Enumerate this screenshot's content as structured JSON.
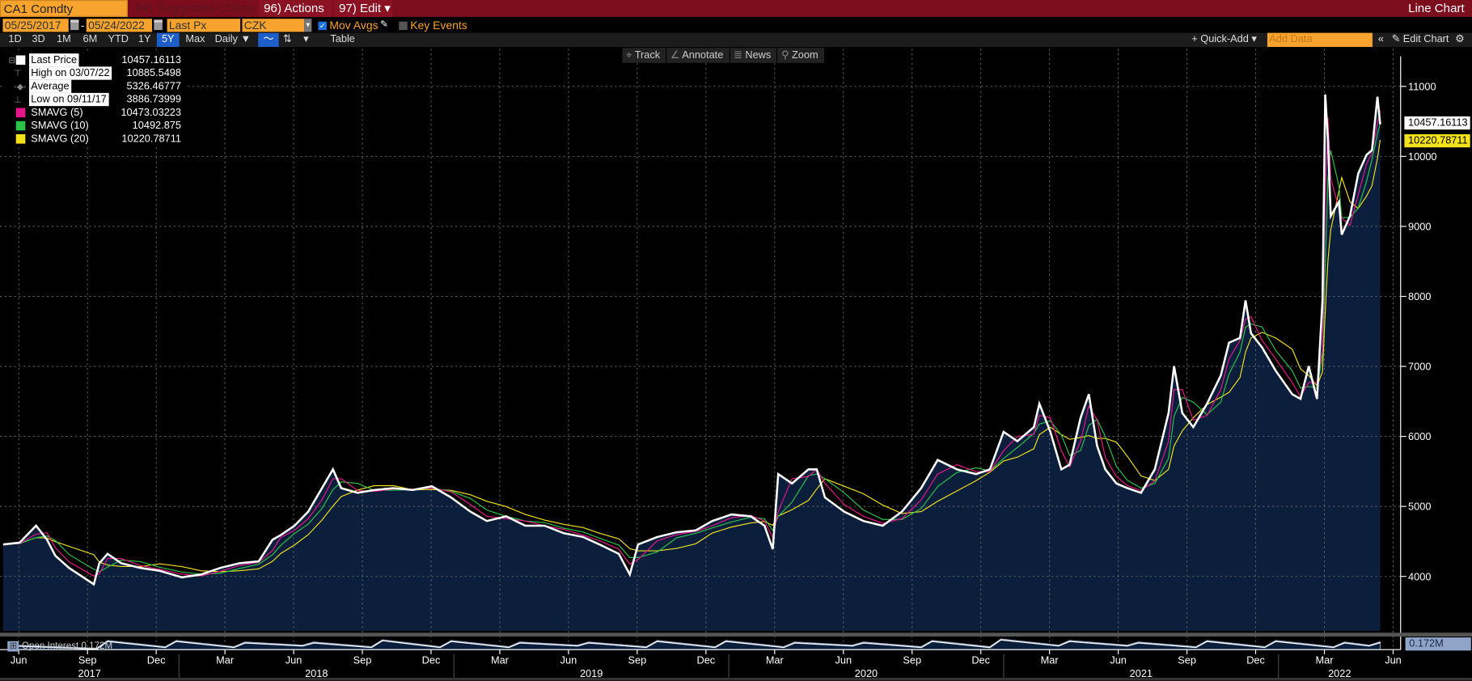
{
  "titlebar": {
    "ticker": "CA1 Comdty",
    "suggested": "94) Suggested Charts",
    "actions": "96) Actions ▾",
    "edit": "97) Edit ▾",
    "view": "Line Chart"
  },
  "controls": {
    "start_date": "05/25/2017",
    "end_date": "05/24/2022",
    "separator": "-",
    "field": "Last Px",
    "currency": "CZK",
    "mov_avgs": "Mov Avgs",
    "mov_avgs_checked": true,
    "key_events": "Key Events",
    "key_events_checked": false
  },
  "periods": [
    "1D",
    "3D",
    "1M",
    "6M",
    "YTD",
    "1Y",
    "5Y",
    "Max"
  ],
  "selected_period": "5Y",
  "frequency": "Daily ▼",
  "table_label": "Table",
  "right_toolbar": {
    "quick_add": "+ Quick-Add ▾",
    "add_data_placeholder": "Add Data",
    "collapse": "«",
    "edit_chart": "Edit Chart"
  },
  "chart_tools": [
    "Track",
    "Annotate",
    "News",
    "Zoom"
  ],
  "legend": [
    {
      "name": "Last Price",
      "value": "10457.16113",
      "color": "#ffffff"
    },
    {
      "name": "High on 03/07/22",
      "value": "10885.5498"
    },
    {
      "name": "Average",
      "value": "5326.46777"
    },
    {
      "name": "Low on 09/11/17",
      "value": "3886.73999"
    },
    {
      "name": "SMAVG (5)",
      "value": "10473.03223",
      "color": "#e8168a"
    },
    {
      "name": "SMAVG (10)",
      "value": "10492.875",
      "color": "#2cc24a"
    },
    {
      "name": "SMAVG (20)",
      "value": "10220.78711",
      "color": "#f2e21c"
    }
  ],
  "price_tags": {
    "last": "10457.16113",
    "smavg20": "10220.78711",
    "open_interest": "0.172M"
  },
  "open_interest_label": "Open Interest 0.172M",
  "chart_data": {
    "type": "area",
    "ylim": [
      3400,
      11500
    ],
    "y_ticks": [
      4000,
      5000,
      6000,
      7000,
      8000,
      9000,
      10000,
      11000
    ],
    "x_ticks": [
      {
        "label": "Jun",
        "t": 2017.417
      },
      {
        "label": "Sep",
        "t": 2017.667
      },
      {
        "label": "Dec",
        "t": 2017.917
      },
      {
        "label": "Mar",
        "t": 2018.167
      },
      {
        "label": "Jun",
        "t": 2018.417
      },
      {
        "label": "Sep",
        "t": 2018.667
      },
      {
        "label": "Dec",
        "t": 2018.917
      },
      {
        "label": "Mar",
        "t": 2019.167
      },
      {
        "label": "Jun",
        "t": 2019.417
      },
      {
        "label": "Sep",
        "t": 2019.667
      },
      {
        "label": "Dec",
        "t": 2019.917
      },
      {
        "label": "Mar",
        "t": 2020.167
      },
      {
        "label": "Jun",
        "t": 2020.417
      },
      {
        "label": "Sep",
        "t": 2020.667
      },
      {
        "label": "Dec",
        "t": 2020.917
      },
      {
        "label": "Mar",
        "t": 2021.167
      },
      {
        "label": "Jun",
        "t": 2021.417
      },
      {
        "label": "Sep",
        "t": 2021.667
      },
      {
        "label": "Dec",
        "t": 2021.917
      },
      {
        "label": "Mar",
        "t": 2022.167
      },
      {
        "label": "Jun",
        "t": 2022.417
      }
    ],
    "years": [
      "2017",
      "2018",
      "2019",
      "2020",
      "2021",
      "2022"
    ],
    "series": [
      {
        "name": "Last Price",
        "points": [
          [
            2017.36,
            4456
          ],
          [
            2017.42,
            4483
          ],
          [
            2017.48,
            4724
          ],
          [
            2017.52,
            4523
          ],
          [
            2017.55,
            4295
          ],
          [
            2017.6,
            4121
          ],
          [
            2017.69,
            3887
          ],
          [
            2017.71,
            4188
          ],
          [
            2017.74,
            4322
          ],
          [
            2017.79,
            4188
          ],
          [
            2017.86,
            4121
          ],
          [
            2017.93,
            4080
          ],
          [
            2018.01,
            3987
          ],
          [
            2018.08,
            4027
          ],
          [
            2018.15,
            4121
          ],
          [
            2018.22,
            4188
          ],
          [
            2018.29,
            4215
          ],
          [
            2018.34,
            4523
          ],
          [
            2018.37,
            4590
          ],
          [
            2018.42,
            4724
          ],
          [
            2018.47,
            4925
          ],
          [
            2018.52,
            5261
          ],
          [
            2018.56,
            5529
          ],
          [
            2018.59,
            5261
          ],
          [
            2018.65,
            5194
          ],
          [
            2018.71,
            5234
          ],
          [
            2018.78,
            5261
          ],
          [
            2018.85,
            5234
          ],
          [
            2018.92,
            5287
          ],
          [
            2018.99,
            5127
          ],
          [
            2019.06,
            4925
          ],
          [
            2019.12,
            4791
          ],
          [
            2019.19,
            4858
          ],
          [
            2019.26,
            4724
          ],
          [
            2019.33,
            4724
          ],
          [
            2019.4,
            4617
          ],
          [
            2019.47,
            4563
          ],
          [
            2019.53,
            4456
          ],
          [
            2019.6,
            4322
          ],
          [
            2019.64,
            4027
          ],
          [
            2019.67,
            4456
          ],
          [
            2019.74,
            4563
          ],
          [
            2019.81,
            4630
          ],
          [
            2019.88,
            4657
          ],
          [
            2019.94,
            4791
          ],
          [
            2020.01,
            4885
          ],
          [
            2020.08,
            4858
          ],
          [
            2020.13,
            4724
          ],
          [
            2020.16,
            4389
          ],
          [
            2020.18,
            5462
          ],
          [
            2020.23,
            5328
          ],
          [
            2020.29,
            5529
          ],
          [
            2020.32,
            5529
          ],
          [
            2020.35,
            5127
          ],
          [
            2020.42,
            4925
          ],
          [
            2020.49,
            4791
          ],
          [
            2020.56,
            4724
          ],
          [
            2020.63,
            4925
          ],
          [
            2020.7,
            5261
          ],
          [
            2020.76,
            5663
          ],
          [
            2020.83,
            5529
          ],
          [
            2020.9,
            5462
          ],
          [
            2020.95,
            5529
          ],
          [
            2021.0,
            6065
          ],
          [
            2021.05,
            5931
          ],
          [
            2021.11,
            6132
          ],
          [
            2021.13,
            6467
          ],
          [
            2021.17,
            6065
          ],
          [
            2021.21,
            5529
          ],
          [
            2021.24,
            5596
          ],
          [
            2021.28,
            6266
          ],
          [
            2021.31,
            6602
          ],
          [
            2021.34,
            5864
          ],
          [
            2021.37,
            5529
          ],
          [
            2021.41,
            5328
          ],
          [
            2021.45,
            5261
          ],
          [
            2021.5,
            5194
          ],
          [
            2021.55,
            5529
          ],
          [
            2021.6,
            6333
          ],
          [
            2021.62,
            7004
          ],
          [
            2021.65,
            6333
          ],
          [
            2021.69,
            6132
          ],
          [
            2021.74,
            6467
          ],
          [
            2021.79,
            6870
          ],
          [
            2021.82,
            7339
          ],
          [
            2021.86,
            7406
          ],
          [
            2021.88,
            7942
          ],
          [
            2021.9,
            7473
          ],
          [
            2021.94,
            7272
          ],
          [
            2021.99,
            6937
          ],
          [
            2022.05,
            6602
          ],
          [
            2022.08,
            6535
          ],
          [
            2022.11,
            7004
          ],
          [
            2022.14,
            6535
          ],
          [
            2022.16,
            7942
          ],
          [
            2022.17,
            10885
          ],
          [
            2022.18,
            10222
          ],
          [
            2022.19,
            9149
          ],
          [
            2022.22,
            9351
          ],
          [
            2022.23,
            8881
          ],
          [
            2022.26,
            9149
          ],
          [
            2022.29,
            9753
          ],
          [
            2022.32,
            10021
          ],
          [
            2022.34,
            10088
          ],
          [
            2022.36,
            10852
          ],
          [
            2022.37,
            10457
          ]
        ]
      }
    ],
    "moving_averages": [
      {
        "name": "SMAVG (5)",
        "window": 2,
        "color": "#e8168a"
      },
      {
        "name": "SMAVG (10)",
        "window": 3,
        "color": "#2cc24a"
      },
      {
        "name": "SMAVG (20)",
        "window": 5,
        "color": "#f2e21c"
      }
    ],
    "open_interest": {
      "unit": "M",
      "ylim": [
        0.12,
        0.2
      ],
      "points": [
        [
          2017.4,
          0.15
        ],
        [
          2017.7,
          0.13
        ],
        [
          2017.74,
          0.18
        ],
        [
          2017.95,
          0.14
        ],
        [
          2017.99,
          0.18
        ],
        [
          2018.2,
          0.14
        ],
        [
          2018.24,
          0.17
        ],
        [
          2018.45,
          0.15
        ],
        [
          2018.49,
          0.17
        ],
        [
          2018.7,
          0.14
        ],
        [
          2018.74,
          0.185
        ],
        [
          2018.95,
          0.14
        ],
        [
          2018.99,
          0.18
        ],
        [
          2019.2,
          0.14
        ],
        [
          2019.24,
          0.17
        ],
        [
          2019.45,
          0.15
        ],
        [
          2019.49,
          0.17
        ],
        [
          2019.7,
          0.14
        ],
        [
          2019.74,
          0.18
        ],
        [
          2019.95,
          0.14
        ],
        [
          2019.99,
          0.18
        ],
        [
          2020.2,
          0.14
        ],
        [
          2020.24,
          0.17
        ],
        [
          2020.45,
          0.15
        ],
        [
          2020.49,
          0.17
        ],
        [
          2020.7,
          0.14
        ],
        [
          2020.74,
          0.18
        ],
        [
          2020.95,
          0.14
        ],
        [
          2020.99,
          0.19
        ],
        [
          2021.2,
          0.15
        ],
        [
          2021.24,
          0.18
        ],
        [
          2021.45,
          0.15
        ],
        [
          2021.49,
          0.17
        ],
        [
          2021.7,
          0.14
        ],
        [
          2021.74,
          0.18
        ],
        [
          2021.95,
          0.14
        ],
        [
          2021.99,
          0.18
        ],
        [
          2022.2,
          0.14
        ],
        [
          2022.24,
          0.17
        ],
        [
          2022.33,
          0.15
        ],
        [
          2022.37,
          0.172
        ]
      ]
    }
  }
}
